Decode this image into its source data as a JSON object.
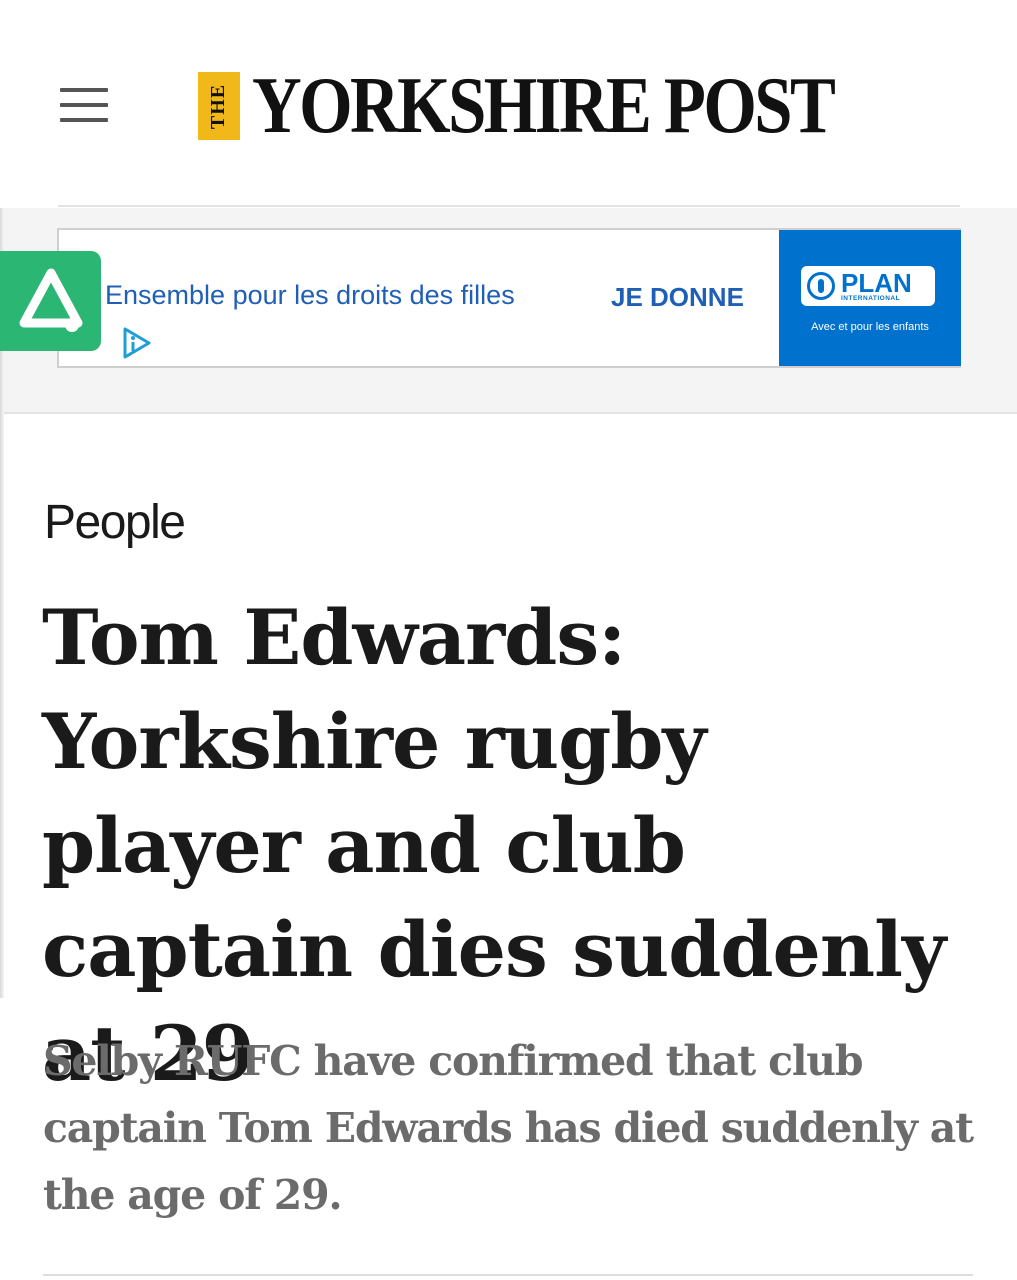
{
  "header": {
    "logo_the": "THE",
    "logo_name": "YORKSHIRE POST"
  },
  "ad": {
    "text": "Ensemble pour les droits des filles",
    "cta": "JE DONNE",
    "brand": "PLAN",
    "brand_sub": "INTERNATIONAL",
    "brand_tagline": "Avec et pour les enfants",
    "brand_color": "#0072ce",
    "text_color": "#1f5fb5"
  },
  "side_tab": {
    "color": "#2bb673",
    "icon": "accessibility-logo-icon"
  },
  "article": {
    "section": "People",
    "headline": "Tom Edwards: Yorkshire rugby player and club captain dies suddenly at 29",
    "standfirst": "Selby RUFC have confirmed that club captain Tom Edwards has died suddenly at the age of 29."
  }
}
